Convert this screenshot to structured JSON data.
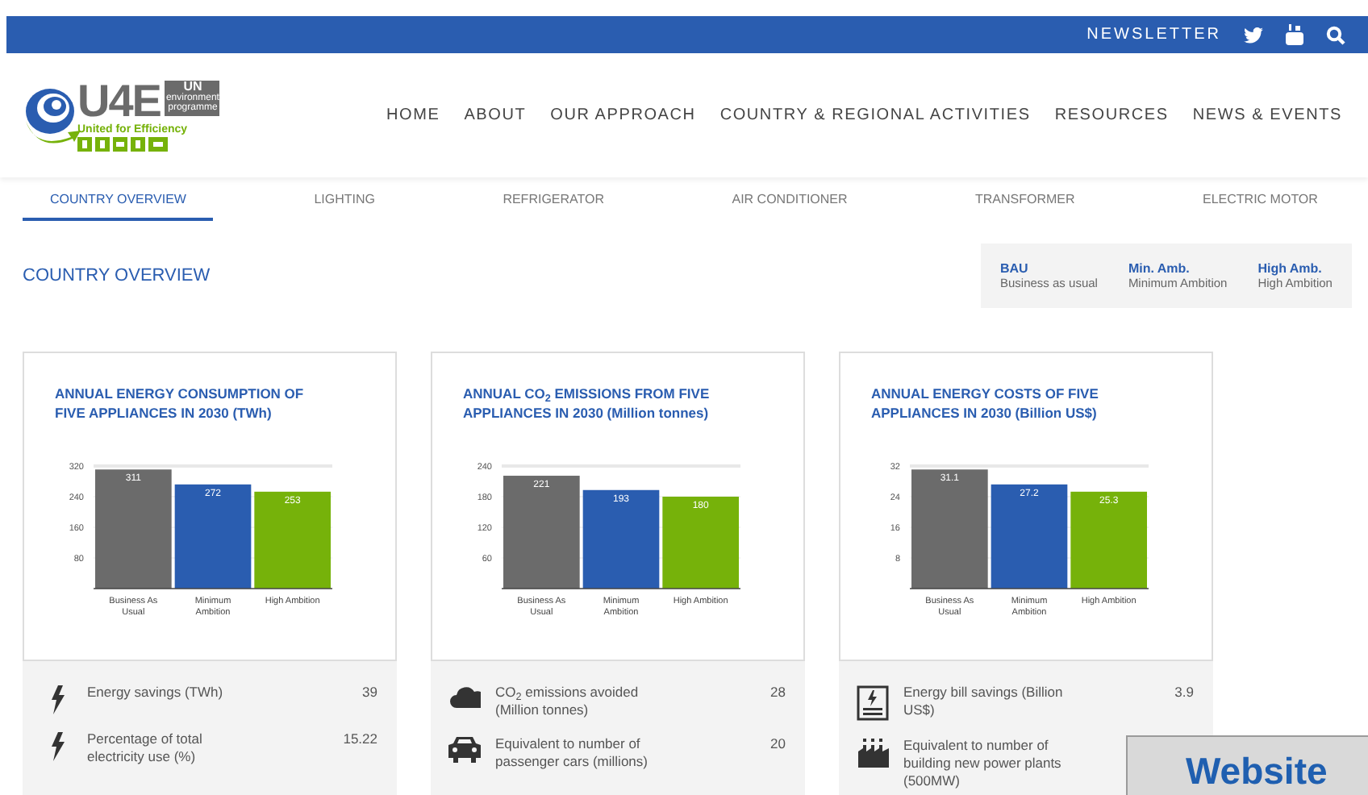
{
  "top_bar": {
    "newsletter": "NEWSLETTER"
  },
  "logo": {
    "name": "U4E",
    "un": "UN",
    "un_sub": "environment programme",
    "tagline": "United for Efficiency"
  },
  "nav": [
    "HOME",
    "ABOUT",
    "OUR APPROACH",
    "COUNTRY & REGIONAL ACTIVITIES",
    "RESOURCES",
    "NEWS & EVENTS"
  ],
  "tabs": [
    {
      "label": "COUNTRY OVERVIEW",
      "selected": true
    },
    {
      "label": "LIGHTING",
      "selected": false
    },
    {
      "label": "REFRIGERATOR",
      "selected": false
    },
    {
      "label": "AIR CONDITIONER",
      "selected": false
    },
    {
      "label": "TRANSFORMER",
      "selected": false
    },
    {
      "label": "ELECTRIC MOTOR",
      "selected": false
    }
  ],
  "section_title": "COUNTRY OVERVIEW",
  "legend": [
    {
      "abbr": "BAU",
      "text": "Business as usual"
    },
    {
      "abbr": "Min. Amb.",
      "text": "Minimum Ambition"
    },
    {
      "abbr": "High Amb.",
      "text": "High Ambition"
    }
  ],
  "cards": [
    {
      "chart_data": {
        "type": "bar",
        "title": "ANNUAL ENERGY CONSUMPTION OF FIVE APPLIANCES IN 2030 (TWh)",
        "stacked": true,
        "grid": true,
        "data_labels": true,
        "ylim": [
          0,
          320
        ],
        "yticks": [
          80,
          160,
          240,
          320
        ],
        "series": [
          {
            "name": "Business As Usual",
            "color": "#6b6b6b",
            "values": [
              311,
              null,
              null
            ]
          },
          {
            "name": "Minimum Ambition",
            "color": "#2a5db0",
            "values": [
              null,
              272,
              null
            ]
          },
          {
            "name": "High Ambition",
            "color": "#76b20a",
            "values": [
              null,
              null,
              253
            ]
          }
        ]
      },
      "stats": [
        {
          "kind": "bolt",
          "label": "Energy savings (TWh)",
          "value": "39"
        },
        {
          "kind": "bolt",
          "label": "Percentage of total electricity use (%)",
          "value": "15.22"
        }
      ]
    },
    {
      "chart_data": {
        "type": "bar",
        "title": "ANNUAL CO$_{2}$ EMISSIONS FROM FIVE APPLIANCES IN 2030 (Million tonnes)",
        "stacked": true,
        "grid": true,
        "data_labels": true,
        "ylim": [
          0,
          240
        ],
        "yticks": [
          60,
          120,
          180,
          240
        ],
        "series": [
          {
            "name": "Business As Usual",
            "color": "#6b6b6b",
            "values": [
              221,
              null,
              null
            ]
          },
          {
            "name": "Minimum Ambition",
            "color": "#2a5db0",
            "values": [
              null,
              193,
              null
            ]
          },
          {
            "name": "High Ambition",
            "color": "#76b20a",
            "values": [
              null,
              null,
              180
            ]
          }
        ]
      },
      "stats": [
        {
          "kind": "cloud",
          "label": "CO$_{2}$ emissions avoided (Million tonnes)",
          "value": "28"
        },
        {
          "kind": "car",
          "label": "Equivalent to number of passenger cars (millions)",
          "value": "20"
        }
      ]
    },
    {
      "chart_data": {
        "type": "bar",
        "title": "ANNUAL ENERGY COSTS OF FIVE APPLIANCES IN 2030 (Billion US$)",
        "stacked": true,
        "grid": true,
        "data_labels": true,
        "ylim": [
          0,
          32
        ],
        "yticks": [
          8,
          16,
          24,
          32
        ],
        "series": [
          {
            "name": "Business As Usual",
            "color": "#6b6b6b",
            "values": [
              31.1,
              null,
              null
            ]
          },
          {
            "name": "Minimum Ambition",
            "color": "#2a5db0",
            "values": [
              null,
              27.2,
              null
            ]
          },
          {
            "name": "High Ambition",
            "color": "#76b20a",
            "values": [
              null,
              null,
              25.3
            ]
          }
        ]
      },
      "stats": [
        {
          "kind": "bill",
          "label": "Energy bill savings (Billion US$)",
          "value": "3.9"
        },
        {
          "kind": "factory",
          "label": "Equivalent to number of building new power plants (500MW)"
        }
      ]
    }
  ],
  "overlay": {
    "text": "Website"
  }
}
